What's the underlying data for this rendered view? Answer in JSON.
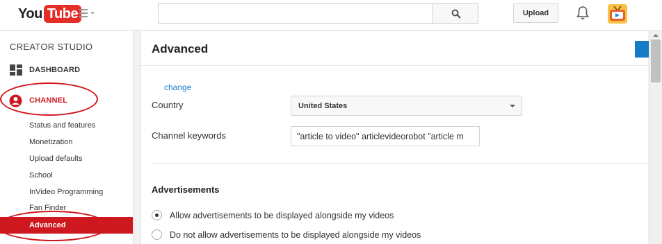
{
  "header": {
    "logo_you": "You",
    "logo_tube": "Tube",
    "search_value": "",
    "upload_label": "Upload"
  },
  "sidebar": {
    "title": "CREATOR STUDIO",
    "dashboard": "DASHBOARD",
    "channel": "CHANNEL",
    "items": [
      "Status and features",
      "Monetization",
      "Upload defaults",
      "School",
      "InVideo Programming",
      "Fan Finder"
    ],
    "active_item": "Advanced"
  },
  "main": {
    "title": "Advanced",
    "change_link": "change",
    "country_label": "Country",
    "country_value": "United States",
    "keywords_label": "Channel keywords",
    "keywords_value": "\"article to video\" articlevideorobot \"article m",
    "ads_title": "Advertisements",
    "ads_options": [
      "Allow advertisements to be displayed alongside my videos",
      "Do not allow advertisements to be displayed alongside my videos"
    ],
    "ads_selected": 0
  },
  "colors": {
    "brand_red": "#e52d27",
    "active_red": "#cc181e",
    "link_blue": "#167ac6",
    "annotation_ring": "#d0141a"
  },
  "icons": [
    "menu-icon",
    "search-icon",
    "bell-icon",
    "avatar-icon",
    "dashboard-icon",
    "channel-person-icon",
    "dropdown-caret-icon"
  ]
}
